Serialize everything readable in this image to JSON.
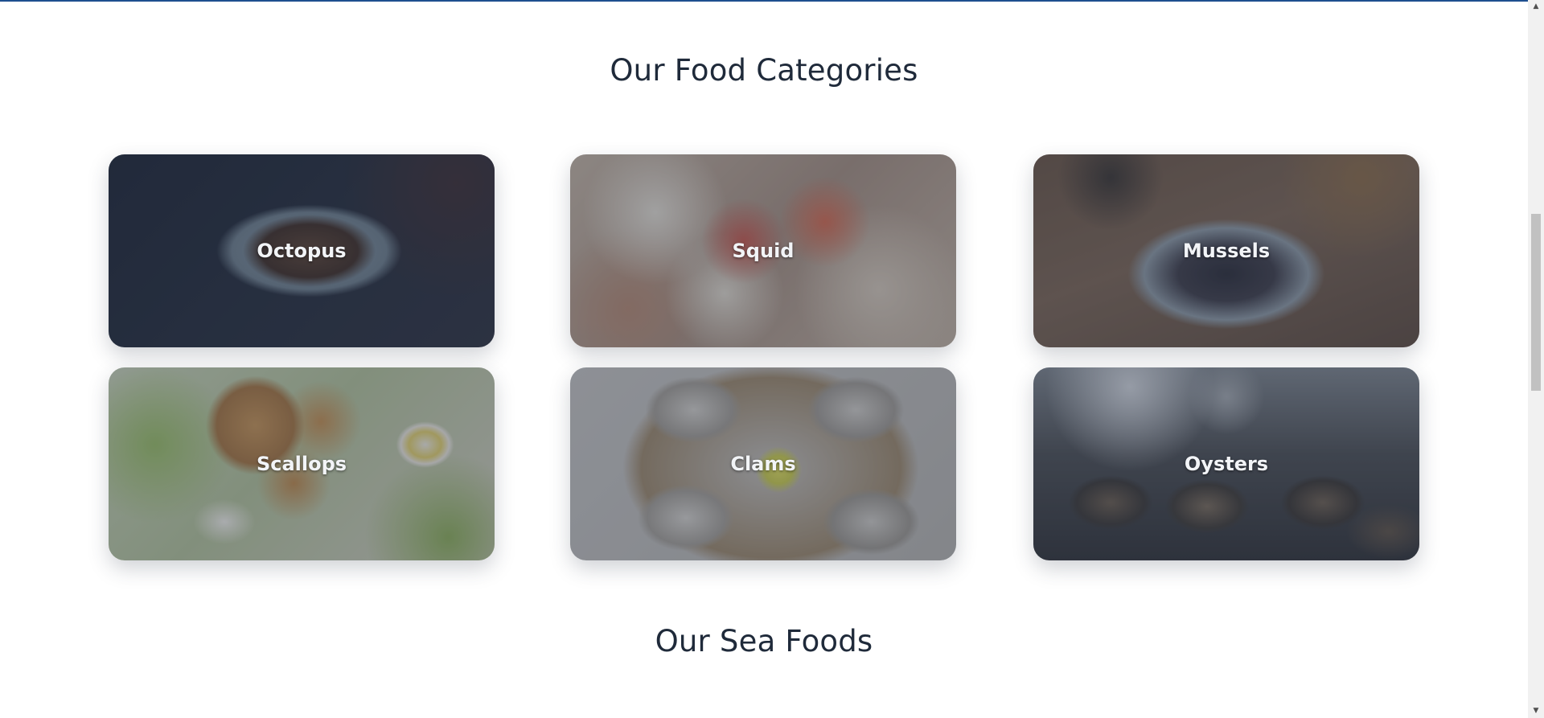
{
  "sections": {
    "categories_title": "Our Food Categories",
    "seafoods_title": "Our Sea Foods"
  },
  "categories": [
    {
      "label": "Octopus",
      "image": "octopus-dish-photo"
    },
    {
      "label": "Squid",
      "image": "squid-salad-photo"
    },
    {
      "label": "Mussels",
      "image": "mussels-plate-photo"
    },
    {
      "label": "Scallops",
      "image": "scallops-salad-photo"
    },
    {
      "label": "Clams",
      "image": "clams-platter-photo"
    },
    {
      "label": "Oysters",
      "image": "oysters-tray-photo"
    }
  ],
  "scrollbar": {
    "up_icon": "scroll-up-arrow-icon",
    "down_icon": "scroll-down-arrow-icon"
  },
  "colors": {
    "accent_topbar": "#1e4f8f",
    "heading": "#1f2a3a",
    "card_label": "#f2f4f7"
  }
}
